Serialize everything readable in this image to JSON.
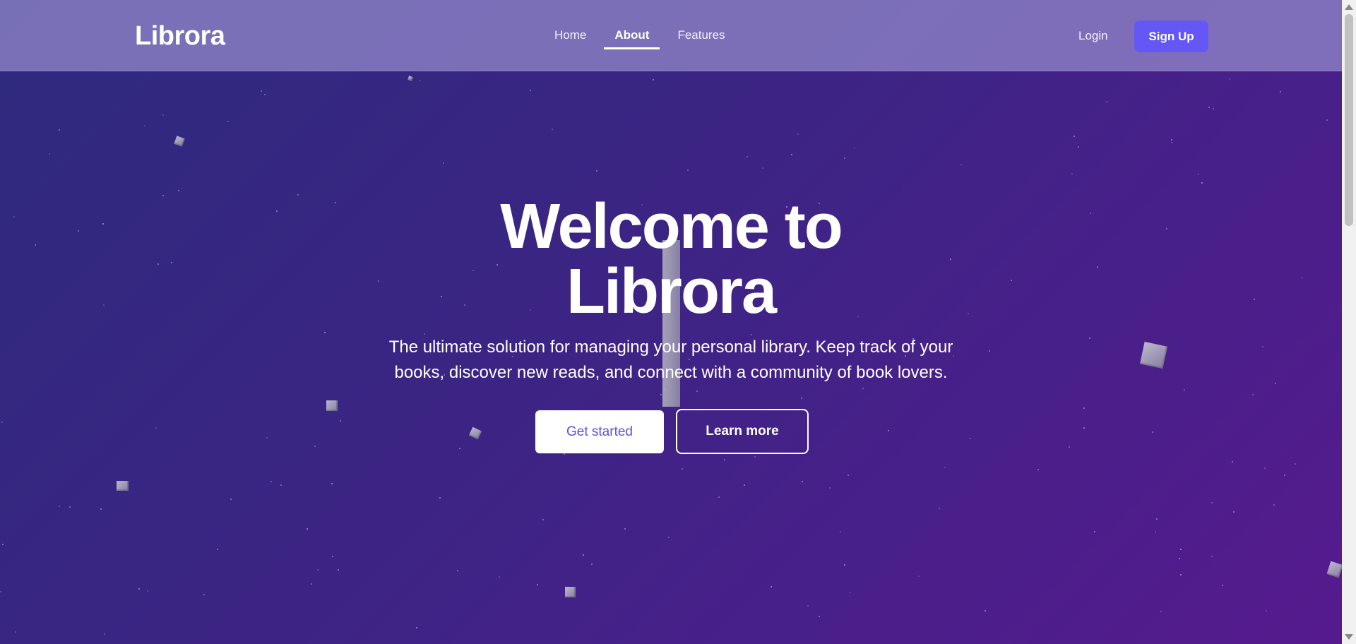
{
  "brand": {
    "name": "Librora"
  },
  "nav": {
    "links": [
      {
        "label": "Home",
        "active": false
      },
      {
        "label": "About",
        "active": true
      },
      {
        "label": "Features",
        "active": false
      }
    ],
    "login_label": "Login",
    "signup_label": "Sign Up"
  },
  "hero": {
    "title": "Welcome to Librora",
    "subtitle": "The ultimate solution for managing your personal library. Keep track of your books, discover new reads, and connect with a community of book lovers.",
    "primary_cta": "Get started",
    "secondary_cta": "Learn more"
  },
  "colors": {
    "background_start": "#2e2a7e",
    "background_end": "#561a8e",
    "navbar": "#968ccd",
    "accent_button": "#6457f5",
    "primary_cta_text": "#5a4ee8"
  },
  "icons": {
    "scroll_up": "triangle-up-icon",
    "scroll_down": "triangle-down-icon"
  }
}
